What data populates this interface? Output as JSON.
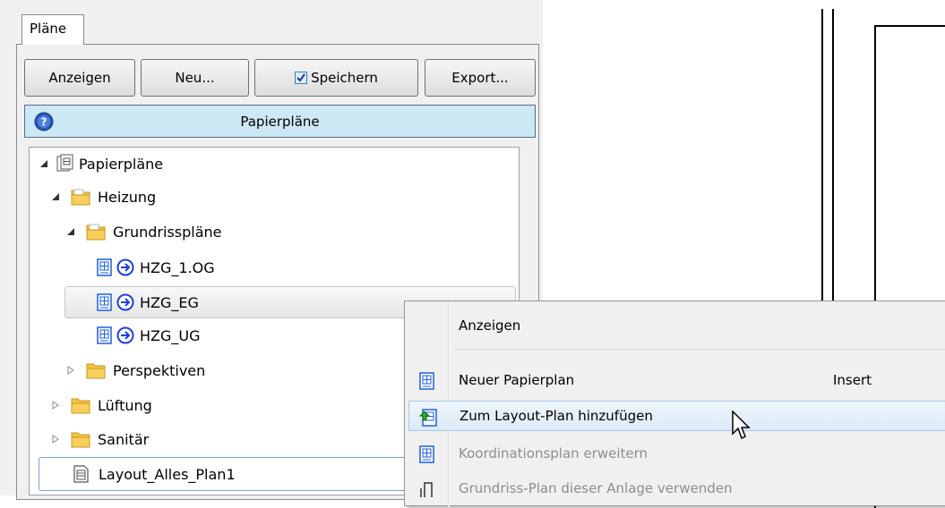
{
  "panel": {
    "tab_label": "Pläne",
    "buttons": {
      "anzeigen": "Anzeigen",
      "neu": "Neu...",
      "speichern": "Speichern",
      "export": "Export..."
    },
    "speichern_checked": true,
    "header_title": "Papierpläne"
  },
  "tree": {
    "root": "Papierpläne",
    "heizung": "Heizung",
    "grundrissplaene": "Grundrisspläne",
    "plan_1og": "HZG_1.OG",
    "plan_eg": "HZG_EG",
    "plan_ug": "HZG_UG",
    "perspektiven": "Perspektiven",
    "lueftung": "Lüftung",
    "sanitaer": "Sanitär",
    "layout": "Layout_Alles_Plan1"
  },
  "context_menu": {
    "anzeigen": "Anzeigen",
    "neuer_papierplan": "Neuer Papierplan",
    "neuer_papierplan_shortcut": "Insert",
    "zum_layout": "Zum Layout-Plan hinzufügen",
    "koordinationsplan": "Koordinationsplan erweitern",
    "grundriss_plan": "Grundriss-Plan dieser Anlage verwenden"
  },
  "colors": {
    "header_bg": "#cce8f4",
    "folder": "#f5c542",
    "plan_blue": "#1e5fd8",
    "hover_bg": "#dceaf8"
  }
}
